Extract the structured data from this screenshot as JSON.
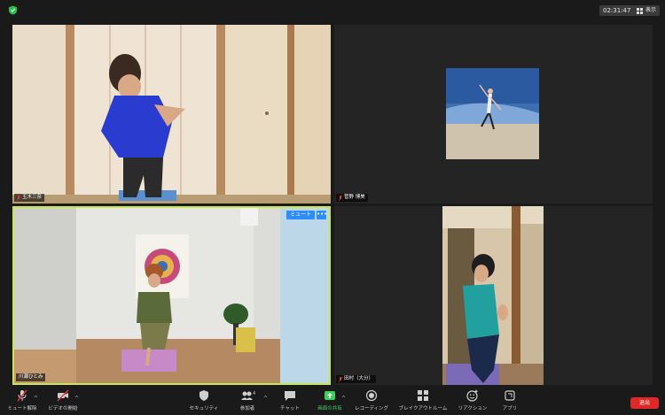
{
  "header": {
    "timer": "02:31:47",
    "view_label": "表示"
  },
  "participants": [
    {
      "name": "玉木三奈"
    },
    {
      "name": "菅野 博美"
    },
    {
      "name": "川瀬ひとみ",
      "mute_label": "ミュート",
      "more_label": "•••"
    },
    {
      "name": "田村（大分）"
    }
  ],
  "toolbar": {
    "mute_label": "ミュート解除",
    "video_label": "ビデオの開始",
    "security_label": "セキュリティ",
    "participants_label": "参加者",
    "participants_count": "4",
    "chat_label": "チャット",
    "share_label": "画面の共有",
    "record_label": "レコーディング",
    "breakout_label": "ブレイクアウトルーム",
    "reactions_label": "リアクション",
    "apps_label": "アプリ",
    "leave_label": "退出"
  },
  "colors": {
    "active_border": "#c8e84c",
    "share_green": "#3bd25b",
    "leave_red": "#e02828",
    "mute_blue": "#2d8cff"
  }
}
